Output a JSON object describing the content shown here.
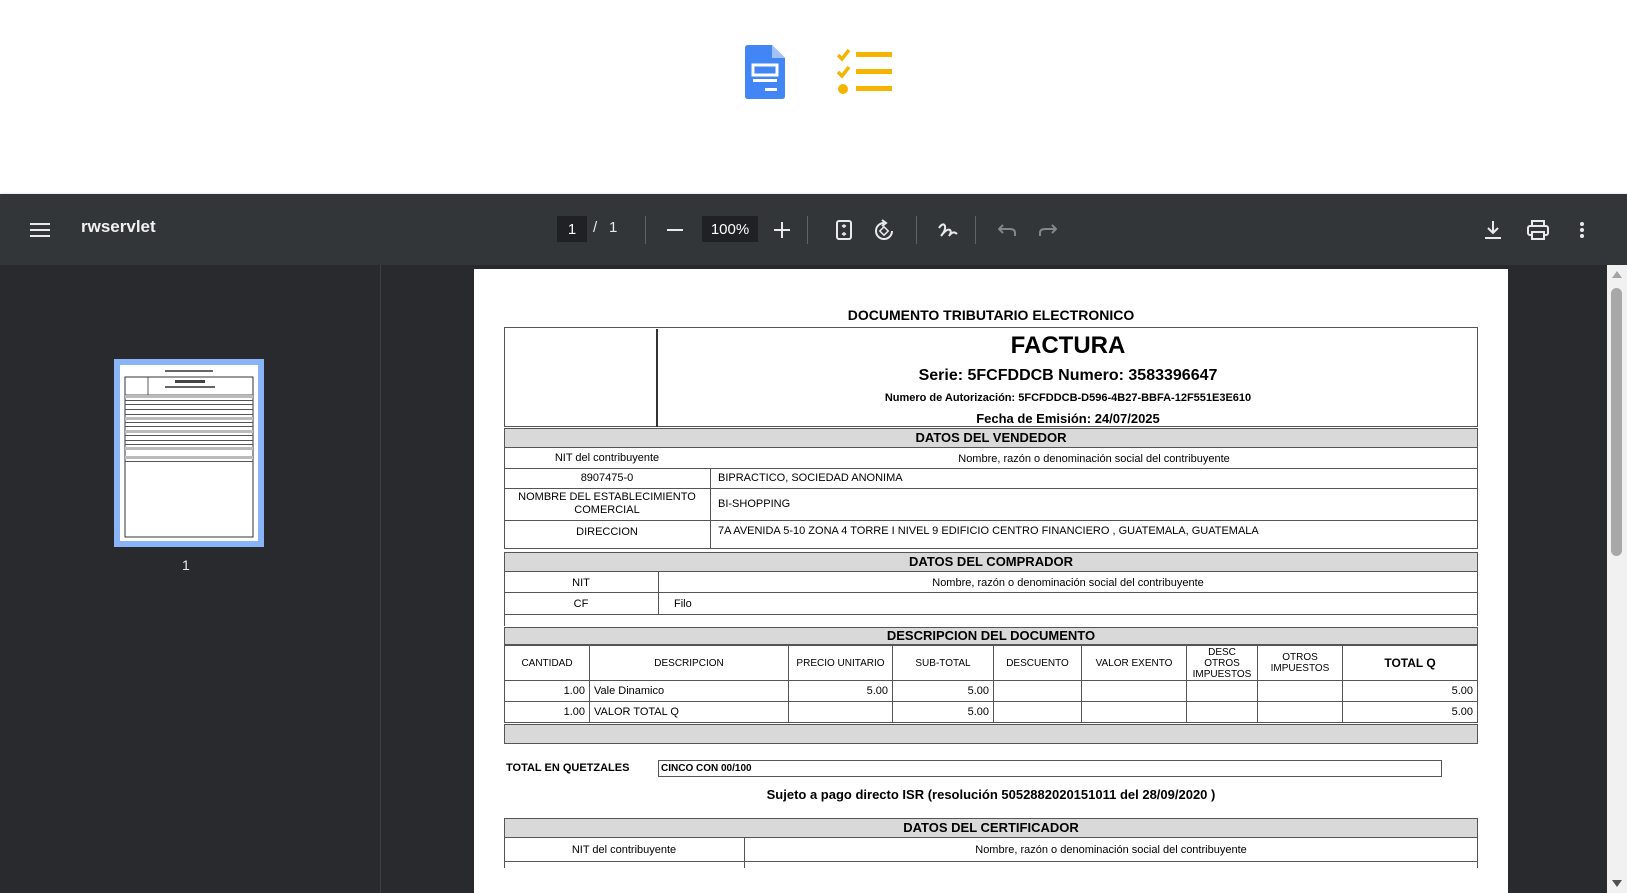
{
  "app": {
    "title": "rwservlet",
    "page_current": "1",
    "page_separator": "/",
    "page_total": "1",
    "zoom": "100%",
    "thumbnail_label": "1"
  },
  "colors": {
    "toolbar": "#323639",
    "background": "#282a2d",
    "accent_blue": "#4285f4",
    "accent_orange": "#f4b400"
  },
  "icons": [
    "document-icon",
    "checklist-icon",
    "menu-icon",
    "minus-icon",
    "plus-icon",
    "fit-page-icon",
    "rotate-icon",
    "draw-icon",
    "undo-icon",
    "redo-icon",
    "download-icon",
    "print-icon",
    "more-icon"
  ],
  "document": {
    "heading": "DOCUMENTO TRIBUTARIO ELECTRONICO",
    "title": "FACTURA",
    "serie_line": "Serie: 5FCFDDCB  Numero: 3583396647",
    "autorizacion": "Numero de Autorización: 5FCFDDCB-D596-4B27-BBFA-12F551E3E610",
    "fecha": "Fecha de Emisión: 24/07/2025",
    "vendedor": {
      "title": "DATOS DEL VENDEDOR",
      "nit_label": "NIT del contribuyente",
      "nombre_label": "Nombre, razón o denominación social del contribuyente",
      "nit": "8907475-0",
      "nombre": "BIPRACTICO, SOCIEDAD ANONIMA",
      "est_label": "NOMBRE DEL ESTABLECIMIENTO COMERCIAL",
      "est": "BI-SHOPPING",
      "dir_label": "DIRECCION",
      "dir": "7A AVENIDA 5-10  ZONA 4 TORRE I NIVEL 9 EDIFICIO CENTRO FINANCIERO , GUATEMALA, GUATEMALA"
    },
    "comprador": {
      "title": "DATOS DEL COMPRADOR",
      "nit_label": "NIT",
      "nombre_label": "Nombre, razón o denominación social del contribuyente",
      "nit": "CF",
      "nombre": "Filo"
    },
    "descripcion": {
      "title": "DESCRIPCION DEL DOCUMENTO",
      "headers": [
        "CANTIDAD",
        "DESCRIPCION",
        "PRECIO UNITARIO",
        "SUB-TOTAL",
        "DESCUENTO",
        "VALOR EXENTO",
        "DESC OTROS IMPUESTOS",
        "OTROS IMPUESTOS",
        "TOTAL Q"
      ],
      "rows": [
        [
          "1.00",
          "Vale Dinamico",
          "5.00",
          "5.00",
          "",
          "",
          "",
          "",
          "5.00"
        ],
        [
          "1.00",
          "VALOR TOTAL Q",
          "",
          "5.00",
          "",
          "",
          "",
          "",
          "5.00"
        ]
      ]
    },
    "total_label": "TOTAL EN  QUETZALES",
    "total_text": "CINCO CON  00/100",
    "sujeto": "Sujeto a pago directo ISR (resolución 5052882020151011 del 28/09/2020 )",
    "certificador": {
      "title": "DATOS DEL CERTIFICADOR",
      "nit_label": "NIT del contribuyente",
      "nombre_label": "Nombre, razón o denominación social del contribuyente"
    }
  }
}
